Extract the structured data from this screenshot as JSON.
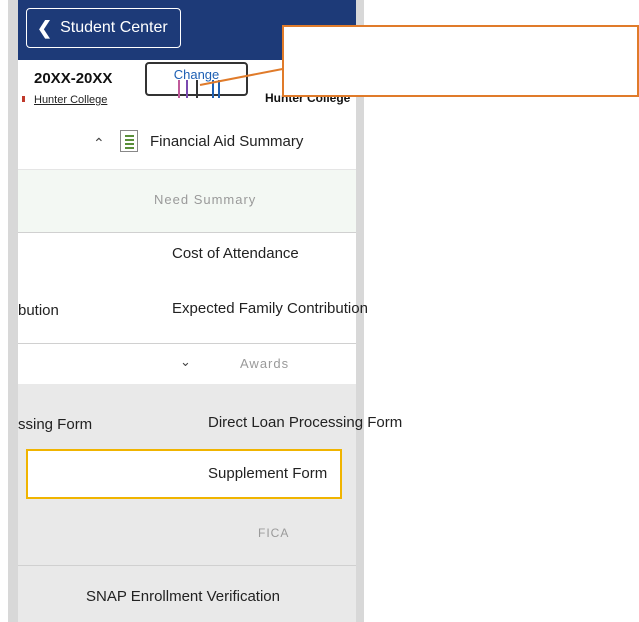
{
  "header": {
    "back_label": "Student Center"
  },
  "term": {
    "year": "20XX-20XX",
    "college": "Hunter College",
    "change_label": "Change",
    "college_secondary": "Hunter College"
  },
  "menu": {
    "section_title": "Financial Aid Summary",
    "items": [
      {
        "label": "Need Summary"
      },
      {
        "label": "Cost of Attendance"
      },
      {
        "label": "Expected Family Contribution",
        "left_fragment": "bution"
      },
      {
        "label": "Awards"
      },
      {
        "label": "Direct Loan Processing Form",
        "left_fragment": "ssing Form"
      },
      {
        "label": "Supplement Form"
      },
      {
        "label": "FICA"
      },
      {
        "label": "SNAP Enrollment Verification"
      }
    ]
  },
  "colors": {
    "header_bg": "#1d3a78",
    "callout_border": "#e07b2a",
    "highlight_border": "#f0b400"
  }
}
